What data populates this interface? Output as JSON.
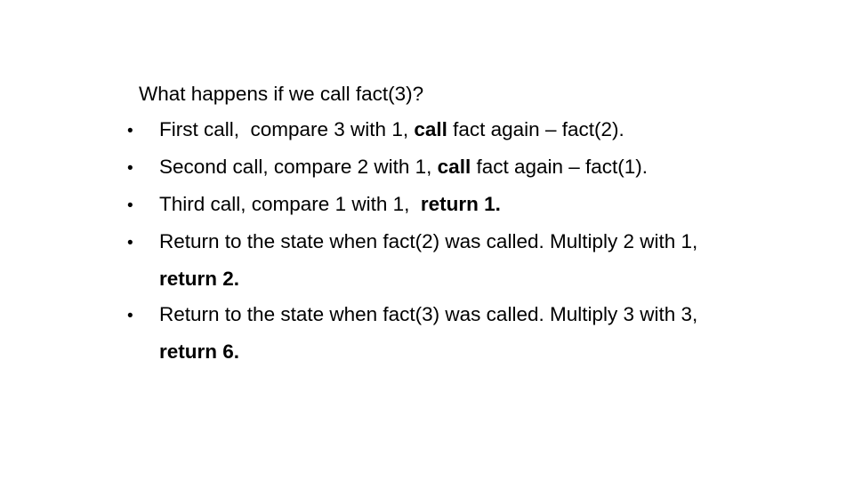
{
  "slide": {
    "heading": "What happens if we call fact(3)?",
    "bullet_marker": "•",
    "bullets": [
      {
        "segments": [
          {
            "text": "First call,  compare 3 with 1, ",
            "bold": false
          },
          {
            "text": "call",
            "bold": true
          },
          {
            "text": " fact again – fact(2).",
            "bold": false
          }
        ]
      },
      {
        "segments": [
          {
            "text": "Second call, compare 2 with 1, ",
            "bold": false
          },
          {
            "text": "call",
            "bold": true
          },
          {
            "text": " fact again – fact(1).",
            "bold": false
          }
        ]
      },
      {
        "segments": [
          {
            "text": "Third call, compare 1 with 1,  ",
            "bold": false
          },
          {
            "text": "return 1.",
            "bold": true
          }
        ]
      },
      {
        "segments": [
          {
            "text": "Return to the state when fact(2) was called. Multiply 2 with 1, ",
            "bold": false
          },
          {
            "text": "return 2.",
            "bold": true
          }
        ]
      },
      {
        "segments": [
          {
            "text": "Return to the state when fact(3) was called. Multiply 3 with 3, ",
            "bold": false
          },
          {
            "text": "return 6.",
            "bold": true
          }
        ]
      }
    ],
    "colors": {
      "background": "#ffffff",
      "text": "#000000"
    }
  }
}
